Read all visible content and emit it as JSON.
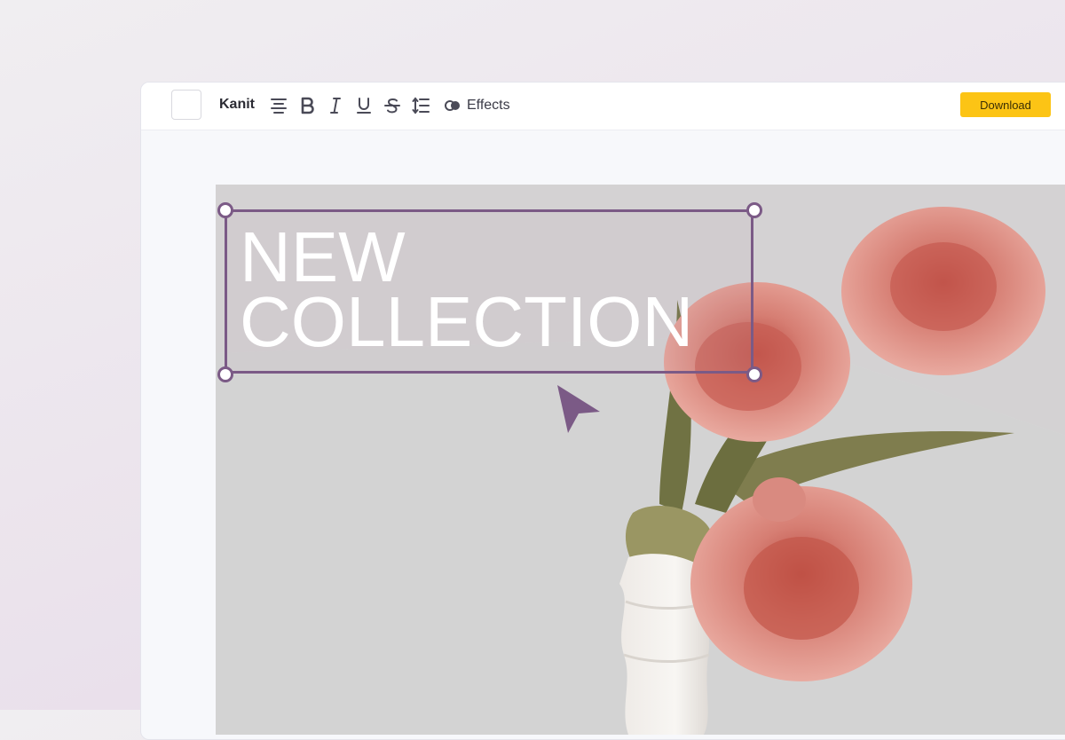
{
  "toolbar": {
    "font_name": "Kanit",
    "effects_label": "Effects",
    "download_label": "Download",
    "tools": [
      "align-center-icon",
      "bold-icon",
      "italic-icon",
      "underline-icon",
      "strikethrough-icon",
      "line-spacing-icon",
      "effects-icon"
    ]
  },
  "canvas": {
    "headline_line1": "NEW",
    "headline_line2": "COLLECTION"
  },
  "colors": {
    "accent": "#7b5a86",
    "download_button": "#fcc415",
    "headline_text": "#ffffff"
  }
}
